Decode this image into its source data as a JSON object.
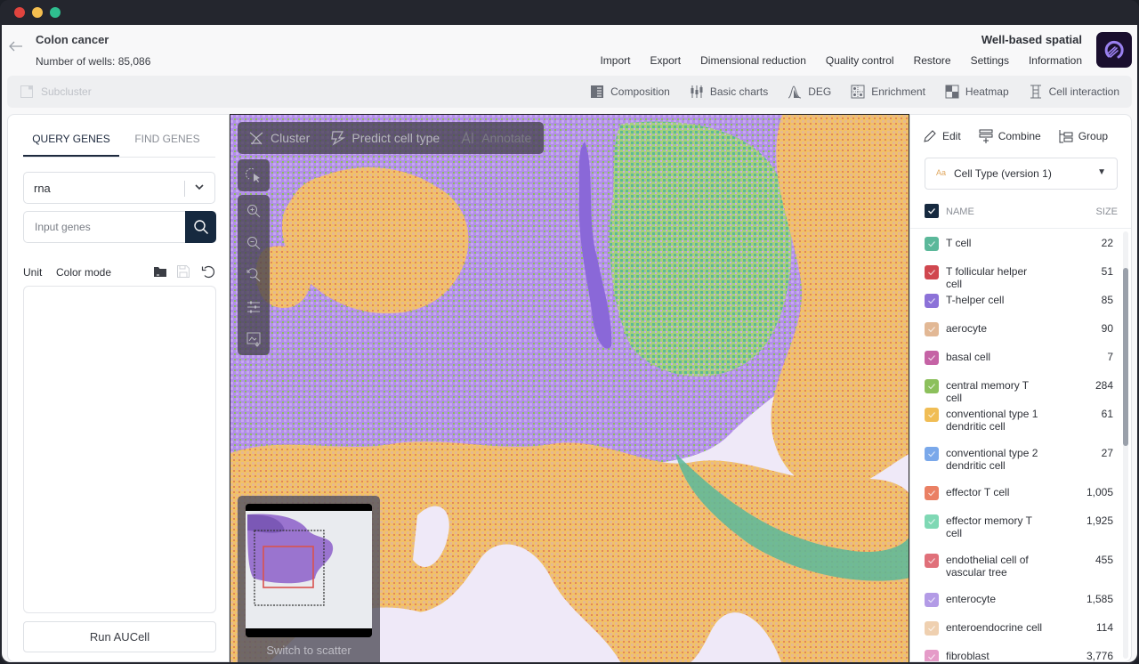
{
  "window": {
    "traffic_lights": {
      "close": "#e0443e",
      "minimize": "#f5bf4f",
      "zoom": "#2fbe8f"
    }
  },
  "header": {
    "back_icon": "arrow-left-icon",
    "title": "Colon cancer",
    "subtitle": "Number of wells: 85,086",
    "app_name": "Well-based spatial",
    "menu": [
      "Import",
      "Export",
      "Dimensional reduction",
      "Quality control",
      "Restore",
      "Settings",
      "Information"
    ]
  },
  "toolbar": {
    "subcluster_label": "Subcluster",
    "tools": [
      {
        "label": "Composition",
        "icon": "composition-icon"
      },
      {
        "label": "Basic charts",
        "icon": "basic-charts-icon"
      },
      {
        "label": "DEG",
        "icon": "deg-icon"
      },
      {
        "label": "Enrichment",
        "icon": "enrichment-icon"
      },
      {
        "label": "Heatmap",
        "icon": "heatmap-icon"
      },
      {
        "label": "Cell interaction",
        "icon": "cell-interaction-icon"
      }
    ]
  },
  "left_panel": {
    "tabs": [
      {
        "label": "QUERY GENES",
        "active": true
      },
      {
        "label": "FIND GENES",
        "active": false
      }
    ],
    "assay_select": {
      "value": "rna"
    },
    "gene_input": {
      "placeholder": "Input genes",
      "value": ""
    },
    "unit_label": "Unit",
    "color_mode_label": "Color mode",
    "run_button": "Run AUCell"
  },
  "viewer": {
    "actions": [
      {
        "label": "Cluster",
        "icon": "cluster-icon",
        "enabled": true
      },
      {
        "label": "Predict cell type",
        "icon": "predict-icon",
        "enabled": true
      },
      {
        "label": "Annotate",
        "icon": "annotate-icon",
        "enabled": false
      }
    ],
    "side_tools": [
      "lasso-select-icon",
      "zoom-in-icon",
      "zoom-out-icon",
      "reset-zoom-icon",
      "adjust-sliders-icon",
      "export-image-icon"
    ],
    "minimap": {
      "switch_label": "Switch to scatter"
    }
  },
  "right_panel": {
    "actions": [
      {
        "label": "Edit",
        "icon": "pencil-icon"
      },
      {
        "label": "Combine",
        "icon": "combine-icon"
      },
      {
        "label": "Group",
        "icon": "group-icon"
      }
    ],
    "metadata_select": {
      "type_badge": "Aa",
      "value": "Cell Type (version 1)"
    },
    "list_header": {
      "name": "NAME",
      "size": "SIZE",
      "all_checked": true
    },
    "cell_types": [
      {
        "name": "T cell",
        "size": "22",
        "color": "#5bb89a",
        "checked": true
      },
      {
        "name": "T follicular helper cell",
        "size": "51",
        "color": "#d0474f",
        "checked": true
      },
      {
        "name": "T-helper cell",
        "size": "85",
        "color": "#8c72d8",
        "checked": true
      },
      {
        "name": "aerocyte",
        "size": "90",
        "color": "#e2b895",
        "checked": true
      },
      {
        "name": "basal cell",
        "size": "7",
        "color": "#c563a5",
        "checked": true
      },
      {
        "name": "central memory T cell",
        "size": "284",
        "color": "#8cc05c",
        "checked": true
      },
      {
        "name": "conventional type 1 dendritic cell",
        "size": "61",
        "color": "#f0bd55",
        "checked": true
      },
      {
        "name": "conventional type 2 dendritic cell",
        "size": "27",
        "color": "#7aa8ea",
        "checked": true
      },
      {
        "name": "effector T cell",
        "size": "1,005",
        "color": "#ea8064",
        "checked": true
      },
      {
        "name": "effector memory T cell",
        "size": "1,925",
        "color": "#7fd8b4",
        "checked": true
      },
      {
        "name": "endothelial cell of vascular tree",
        "size": "455",
        "color": "#e0707a",
        "checked": true
      },
      {
        "name": "enterocyte",
        "size": "1,585",
        "color": "#b39be6",
        "checked": true
      },
      {
        "name": "enteroendocrine cell",
        "size": "114",
        "color": "#efd0b0",
        "checked": true
      },
      {
        "name": "fibroblast",
        "size": "3,776",
        "color": "#e59bc8",
        "checked": true
      }
    ]
  }
}
